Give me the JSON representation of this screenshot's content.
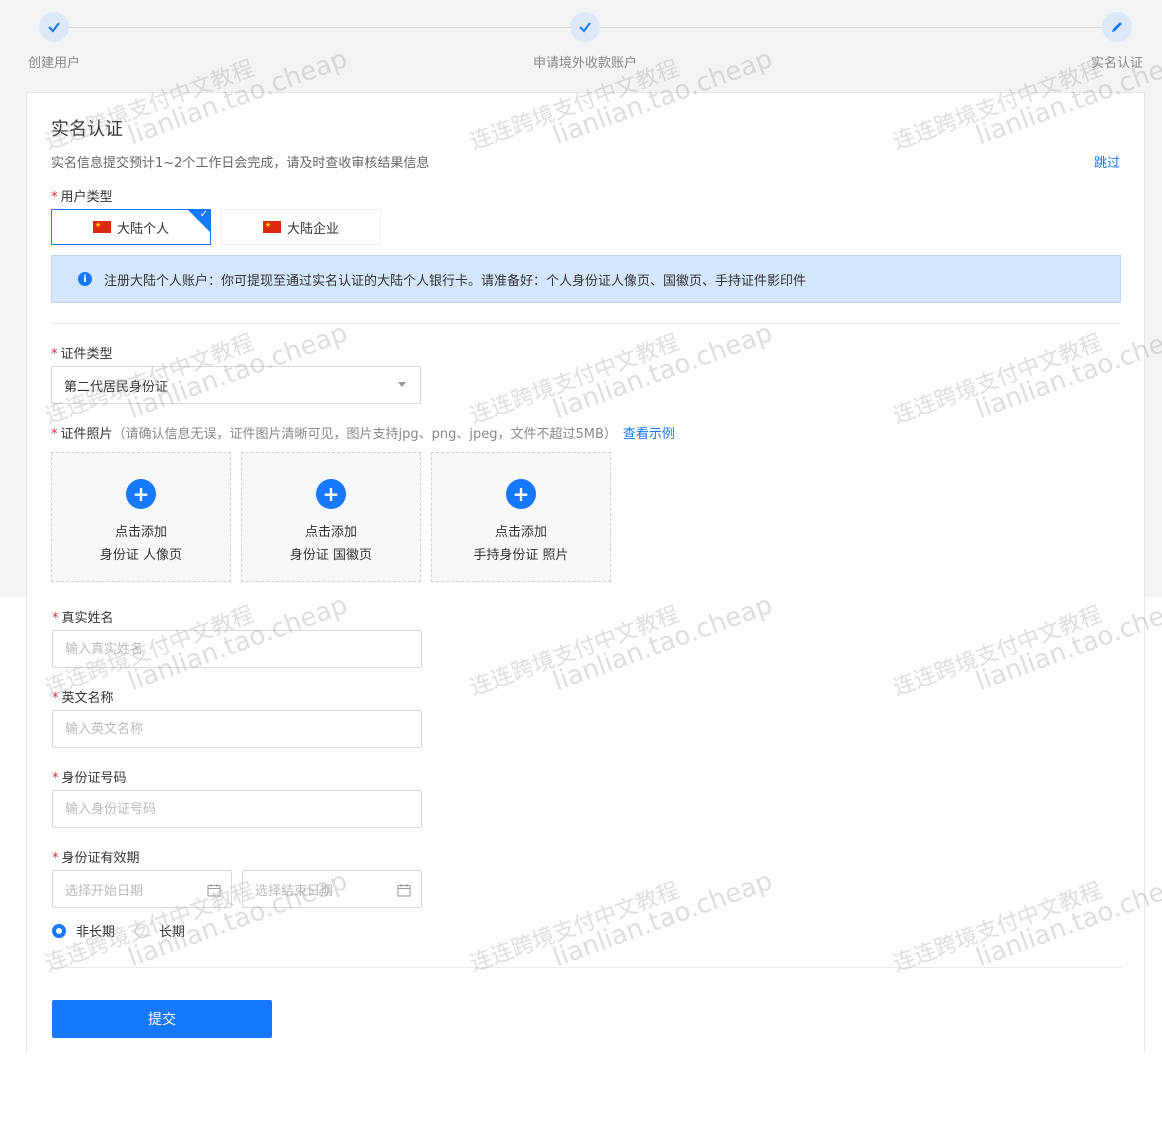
{
  "steps": [
    {
      "label": "创建用户",
      "status": "done"
    },
    {
      "label": "申请境外收款账户",
      "status": "done"
    },
    {
      "label": "实名认证",
      "status": "current"
    }
  ],
  "form": {
    "title": "实名认证",
    "subtitle": "实名信息提交预计1~2个工作日会完成，请及时查收审核结果信息",
    "skip_label": "跳过",
    "user_type": {
      "label": "用户类型",
      "options": [
        {
          "label": "大陆个人",
          "selected": true
        },
        {
          "label": "大陆企业",
          "selected": false
        }
      ]
    },
    "alert_text": "注册大陆个人账户：你可提现至通过实名认证的大陆个人银行卡。请准备好：个人身份证人像页、国徽页、手持证件影印件",
    "id_type": {
      "label": "证件类型",
      "value": "第二代居民身份证"
    },
    "photos": {
      "label": "证件照片",
      "hint": "（请确认信息无误，证件图片清晰可见，图片支持jpg、png、jpeg，文件不超过5MB）",
      "example_link": "查看示例",
      "slots": [
        {
          "action": "点击添加",
          "desc": "身份证 人像页"
        },
        {
          "action": "点击添加",
          "desc": "身份证 国徽页"
        },
        {
          "action": "点击添加",
          "desc": "手持身份证 照片"
        }
      ]
    },
    "real_name": {
      "label": "真实姓名",
      "placeholder": "输入真实姓名"
    },
    "english_name": {
      "label": "英文名称",
      "placeholder": "输入英文名称"
    },
    "id_number": {
      "label": "身份证号码",
      "placeholder": "输入身份证号码"
    },
    "validity": {
      "label": "身份证有效期",
      "start_placeholder": "选择开始日期",
      "end_placeholder": "选择结束日期",
      "options": [
        {
          "label": "非长期",
          "selected": true
        },
        {
          "label": "长期",
          "selected": false
        }
      ]
    },
    "submit_label": "提交"
  },
  "watermark": {
    "line1": "连连跨境支付中文教程",
    "line2": "lianlian.tao.cheap"
  },
  "colors": {
    "primary": "#1677ff",
    "alert_bg": "#d4e6fb",
    "required": "#f5222d"
  }
}
